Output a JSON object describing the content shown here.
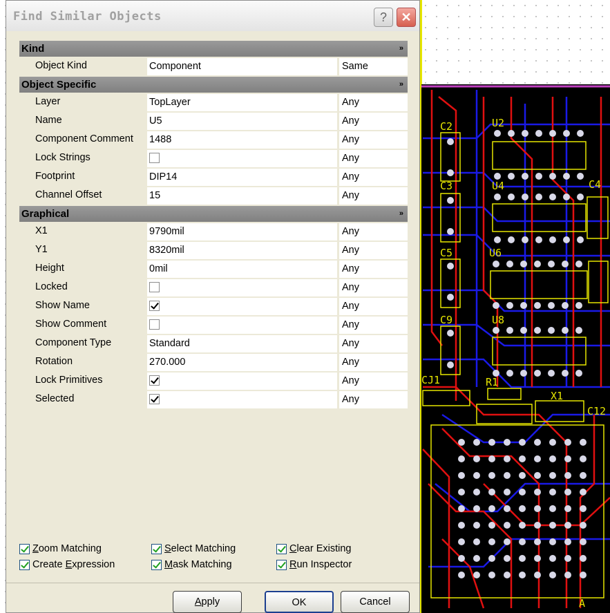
{
  "dialog": {
    "title": "Find Similar Objects",
    "help_label": "?",
    "close_label": "✕"
  },
  "sections": {
    "kind": {
      "label": "Kind",
      "chevron": "»"
    },
    "object_specific": {
      "label": "Object Specific",
      "chevron": "»"
    },
    "graphical": {
      "label": "Graphical",
      "chevron": "»"
    }
  },
  "rows": {
    "object_kind": {
      "label": "Object Kind",
      "value": "Component",
      "mode": "Same"
    },
    "layer": {
      "label": "Layer",
      "value": "TopLayer",
      "mode": "Any"
    },
    "name": {
      "label": "Name",
      "value": "U5",
      "mode": "Any"
    },
    "component_comment": {
      "label": "Component Comment",
      "value": "1488",
      "mode": "Any"
    },
    "lock_strings": {
      "label": "Lock Strings",
      "checked": false,
      "mode": "Any"
    },
    "footprint": {
      "label": "Footprint",
      "value": "DIP14",
      "mode": "Any"
    },
    "channel_offset": {
      "label": "Channel Offset",
      "value": "15",
      "mode": "Any"
    },
    "x1": {
      "label": "X1",
      "value": "9790mil",
      "mode": "Any"
    },
    "y1": {
      "label": "Y1",
      "value": "8320mil",
      "mode": "Any"
    },
    "height": {
      "label": "Height",
      "value": "0mil",
      "mode": "Any"
    },
    "locked": {
      "label": "Locked",
      "checked": false,
      "mode": "Any"
    },
    "show_name": {
      "label": "Show Name",
      "checked": true,
      "mode": "Any"
    },
    "show_comment": {
      "label": "Show Comment",
      "checked": false,
      "mode": "Any"
    },
    "component_type": {
      "label": "Component Type",
      "value": "Standard",
      "mode": "Any"
    },
    "rotation": {
      "label": "Rotation",
      "value": "270.000",
      "mode": "Any"
    },
    "lock_primitives": {
      "label": "Lock Primitives",
      "checked": true,
      "mode": "Any"
    },
    "selected": {
      "label": "Selected",
      "checked": true,
      "mode": "Any"
    }
  },
  "options": {
    "zoom_matching": {
      "mnemonic": "Z",
      "rest": "oom Matching",
      "checked": true
    },
    "select_matching": {
      "mnemonic": "S",
      "rest": "elect Matching",
      "checked": true
    },
    "clear_existing": {
      "mnemonic": "C",
      "rest": "lear Existing",
      "checked": true
    },
    "create_expression": {
      "before": "Create ",
      "mnemonic": "E",
      "rest": "xpression",
      "checked": true
    },
    "mask_matching": {
      "mnemonic": "M",
      "rest": "ask Matching",
      "checked": true
    },
    "run_inspector": {
      "mnemonic": "R",
      "rest": "un Inspector",
      "checked": true
    }
  },
  "buttons": {
    "apply": {
      "mnemonic": "A",
      "rest": "pply"
    },
    "ok": "OK",
    "cancel": "Cancel"
  },
  "pcb": {
    "labels": [
      "C2",
      "U2",
      "C3",
      "U4",
      "C4",
      "C5",
      "U6",
      "C9",
      "U8",
      "CJ1",
      "R1",
      "X1",
      "C12",
      "A"
    ]
  },
  "colors": {
    "dialog_bg": "#ece9d8",
    "section_header": "#8c8c8c",
    "pcb_bg": "#000000",
    "trace_red": "#e01010",
    "trace_blue": "#1a1ae6",
    "silkscreen_yellow": "#e6e600",
    "pad": "#d8d8e8"
  }
}
